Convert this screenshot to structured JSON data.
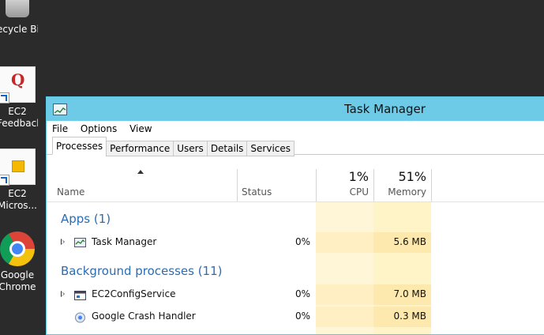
{
  "desktop": {
    "icons": [
      {
        "label": "ecycle Bin"
      },
      {
        "label_line1": "EC2",
        "label_line2": "Feedback"
      },
      {
        "label_line1": "EC2",
        "label_line2": "Micros..."
      },
      {
        "label_line1": "Google",
        "label_line2": "Chrome"
      }
    ]
  },
  "window": {
    "title": "Task Manager",
    "menu": [
      "File",
      "Options",
      "View"
    ],
    "tabs": [
      "Processes",
      "Performance",
      "Users",
      "Details",
      "Services"
    ],
    "active_tab": "Processes",
    "columns": {
      "name": "Name",
      "status": "Status",
      "cpu_pct": "1%",
      "cpu": "CPU",
      "mem_pct": "51%",
      "memory": "Memory"
    },
    "groups": {
      "apps": "Apps (1)",
      "background": "Background processes (11)"
    },
    "processes": [
      {
        "name": "Task Manager",
        "cpu": "0%",
        "memory": "5.6 MB"
      },
      {
        "name": "EC2ConfigService",
        "cpu": "0%",
        "memory": "7.0 MB"
      },
      {
        "name": "Google Crash Handler",
        "cpu": "0%",
        "memory": "0.3 MB"
      }
    ]
  },
  "colors": {
    "titlebar": "#6dcbe8",
    "group_heading": "#2b6cb3",
    "cpu_column": "#fff6d8",
    "memory_column": "#fde8ad"
  }
}
